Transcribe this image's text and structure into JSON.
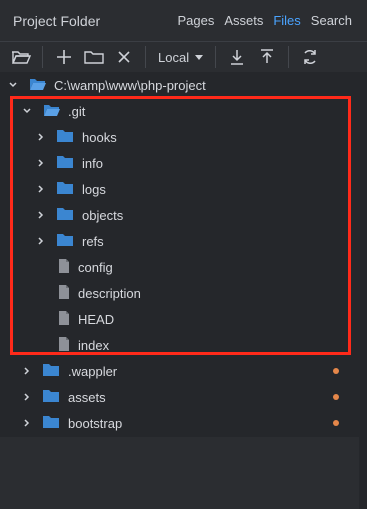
{
  "header": {
    "title": "Project Folder",
    "tabs": [
      "Pages",
      "Assets",
      "Files",
      "Search"
    ],
    "active_tab": "Files"
  },
  "toolbar": {
    "location_label": "Local",
    "icons": [
      "open-folder-icon",
      "add-icon",
      "new-folder-icon",
      "close-icon",
      "download-icon",
      "upload-icon",
      "refresh-icon"
    ]
  },
  "tree": {
    "root_path": "C:\\wamp\\www\\php-project",
    "git_folder": ".git",
    "git_children": [
      {
        "name": "hooks",
        "type": "folder"
      },
      {
        "name": "info",
        "type": "folder"
      },
      {
        "name": "logs",
        "type": "folder"
      },
      {
        "name": "objects",
        "type": "folder"
      },
      {
        "name": "refs",
        "type": "folder"
      },
      {
        "name": "config",
        "type": "file"
      },
      {
        "name": "description",
        "type": "file"
      },
      {
        "name": "HEAD",
        "type": "file"
      },
      {
        "name": "index",
        "type": "file"
      }
    ],
    "siblings": [
      {
        "name": ".wappler",
        "type": "folder"
      },
      {
        "name": "assets",
        "type": "folder"
      },
      {
        "name": "bootstrap",
        "type": "folder"
      }
    ]
  },
  "colors": {
    "accent": "#4aa3ff",
    "folder": "#3b86d1",
    "highlight": "#ff2a1a",
    "modified_dot": "#e5874a"
  }
}
